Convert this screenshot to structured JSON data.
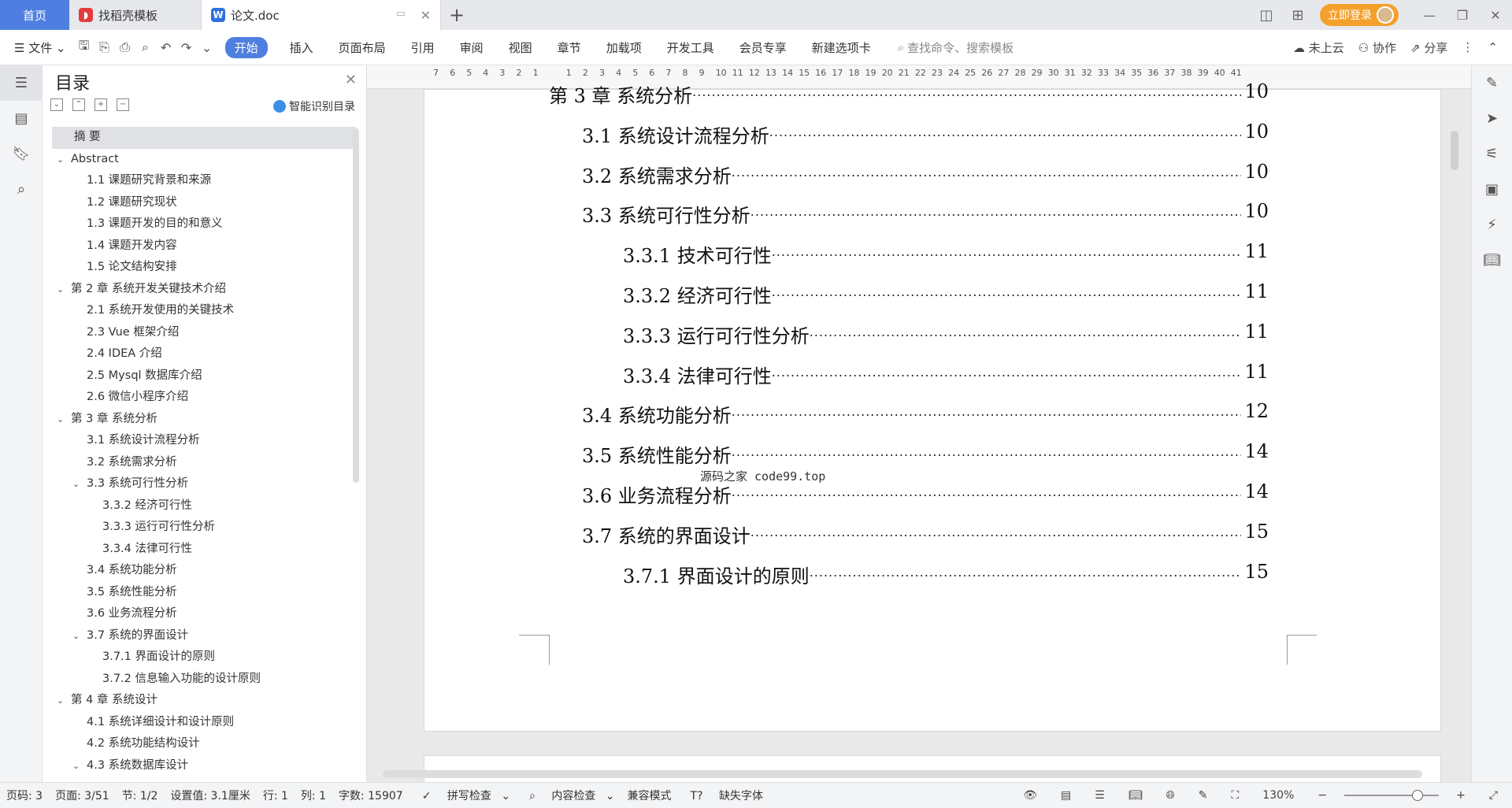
{
  "tabs": {
    "home": "首页",
    "template": "找稻壳模板",
    "doc": "论文.doc"
  },
  "title_bar": {
    "login": "立即登录"
  },
  "ribbon": {
    "file": "文件",
    "start": "开始",
    "menu": [
      "插入",
      "页面布局",
      "引用",
      "审阅",
      "视图",
      "章节",
      "加载项",
      "开发工具",
      "会员专享",
      "新建选项卡"
    ],
    "search": "查找命令、搜索模板",
    "cloud": "未上云",
    "collab": "协作",
    "share": "分享"
  },
  "toc": {
    "title": "目录",
    "smart": "智能识别目录",
    "items": [
      {
        "text": "摘  要",
        "level": 0,
        "sel": true
      },
      {
        "text": "Abstract",
        "level": 0,
        "chev": true
      },
      {
        "text": "1.1 课题研究背景和来源",
        "level": 1
      },
      {
        "text": "1.2 课题研究现状",
        "level": 1
      },
      {
        "text": "1.3 课题开发的目的和意义",
        "level": 1
      },
      {
        "text": "1.4 课题开发内容",
        "level": 1
      },
      {
        "text": "1.5 论文结构安排",
        "level": 1
      },
      {
        "text": "第 2 章  系统开发关键技术介绍",
        "level": 0,
        "chev": true
      },
      {
        "text": "2.1 系统开发使用的关键技术",
        "level": 1
      },
      {
        "text": "2.3 Vue 框架介绍",
        "level": 1
      },
      {
        "text": "2.4 IDEA 介绍",
        "level": 1
      },
      {
        "text": "2.5 Mysql 数据库介绍",
        "level": 1
      },
      {
        "text": "2.6 微信小程序介绍",
        "level": 1
      },
      {
        "text": "第 3 章  系统分析",
        "level": 0,
        "chev": true
      },
      {
        "text": "3.1 系统设计流程分析",
        "level": 1
      },
      {
        "text": "3.2 系统需求分析",
        "level": 1
      },
      {
        "text": "3.3 系统可行性分析",
        "level": 1,
        "chev": true
      },
      {
        "text": "3.3.2 经济可行性",
        "level": 2
      },
      {
        "text": "3.3.3 运行可行性分析",
        "level": 2
      },
      {
        "text": "3.3.4 法律可行性",
        "level": 2
      },
      {
        "text": "3.4 系统功能分析",
        "level": 1
      },
      {
        "text": "3.5 系统性能分析",
        "level": 1
      },
      {
        "text": "3.6 业务流程分析",
        "level": 1
      },
      {
        "text": "3.7 系统的界面设计",
        "level": 1,
        "chev": true
      },
      {
        "text": "3.7.1 界面设计的原则",
        "level": 2
      },
      {
        "text": "3.7.2 信息输入功能的设计原则",
        "level": 2
      },
      {
        "text": "第 4 章  系统设计",
        "level": 0,
        "chev": true
      },
      {
        "text": "4.1 系统详细设计和设计原则",
        "level": 1
      },
      {
        "text": "4.2 系统功能结构设计",
        "level": 1
      },
      {
        "text": "4.3 系统数据库设计",
        "level": 1,
        "chev": true
      }
    ]
  },
  "ruler_ticks": [
    "7",
    "6",
    "5",
    "4",
    "3",
    "2",
    "1",
    "",
    "1",
    "2",
    "3",
    "4",
    "5",
    "6",
    "7",
    "8",
    "9",
    "10",
    "11",
    "12",
    "13",
    "14",
    "15",
    "16",
    "17",
    "18",
    "19",
    "20",
    "21",
    "22",
    "23",
    "24",
    "25",
    "26",
    "27",
    "28",
    "29",
    "30",
    "31",
    "32",
    "33",
    "34",
    "35",
    "36",
    "37",
    "38",
    "39",
    "40",
    "41"
  ],
  "doc_entries": [
    {
      "label": "第 3 章  系统分析",
      "page": "10",
      "indent": 0
    },
    {
      "label": "3.1 系统设计流程分析",
      "page": "10",
      "indent": 1
    },
    {
      "label": "3.2 系统需求分析",
      "page": "10",
      "indent": 1
    },
    {
      "label": "3.3 系统可行性分析",
      "page": "10",
      "indent": 1
    },
    {
      "label": "3.3.1 技术可行性",
      "page": "11",
      "indent": 2
    },
    {
      "label": "3.3.2 经济可行性",
      "page": "11",
      "indent": 2
    },
    {
      "label": "3.3.3 运行可行性分析",
      "page": "11",
      "indent": 2
    },
    {
      "label": "3.3.4 法律可行性",
      "page": "11",
      "indent": 2
    },
    {
      "label": "3.4 系统功能分析",
      "page": "12",
      "indent": 1
    },
    {
      "label": "3.5 系统性能分析",
      "page": "14",
      "indent": 1
    },
    {
      "label": "3.6 业务流程分析",
      "page": "14",
      "indent": 1
    },
    {
      "label": "3.7 系统的界面设计",
      "page": "15",
      "indent": 1
    },
    {
      "label": "3.7.1 界面设计的原则",
      "page": "15",
      "indent": 2
    }
  ],
  "watermark": "源码之家 code99.top",
  "status": {
    "page_no": "页码: 3",
    "pages": "页面: 3/51",
    "section": "节: 1/2",
    "setting": "设置值: 3.1厘米",
    "row": "行: 1",
    "col": "列: 1",
    "words": "字数: 15907",
    "spell": "拼写检查",
    "content_check": "内容检查",
    "compat": "兼容模式",
    "missing_font": "缺失字体",
    "zoom": "130%"
  }
}
